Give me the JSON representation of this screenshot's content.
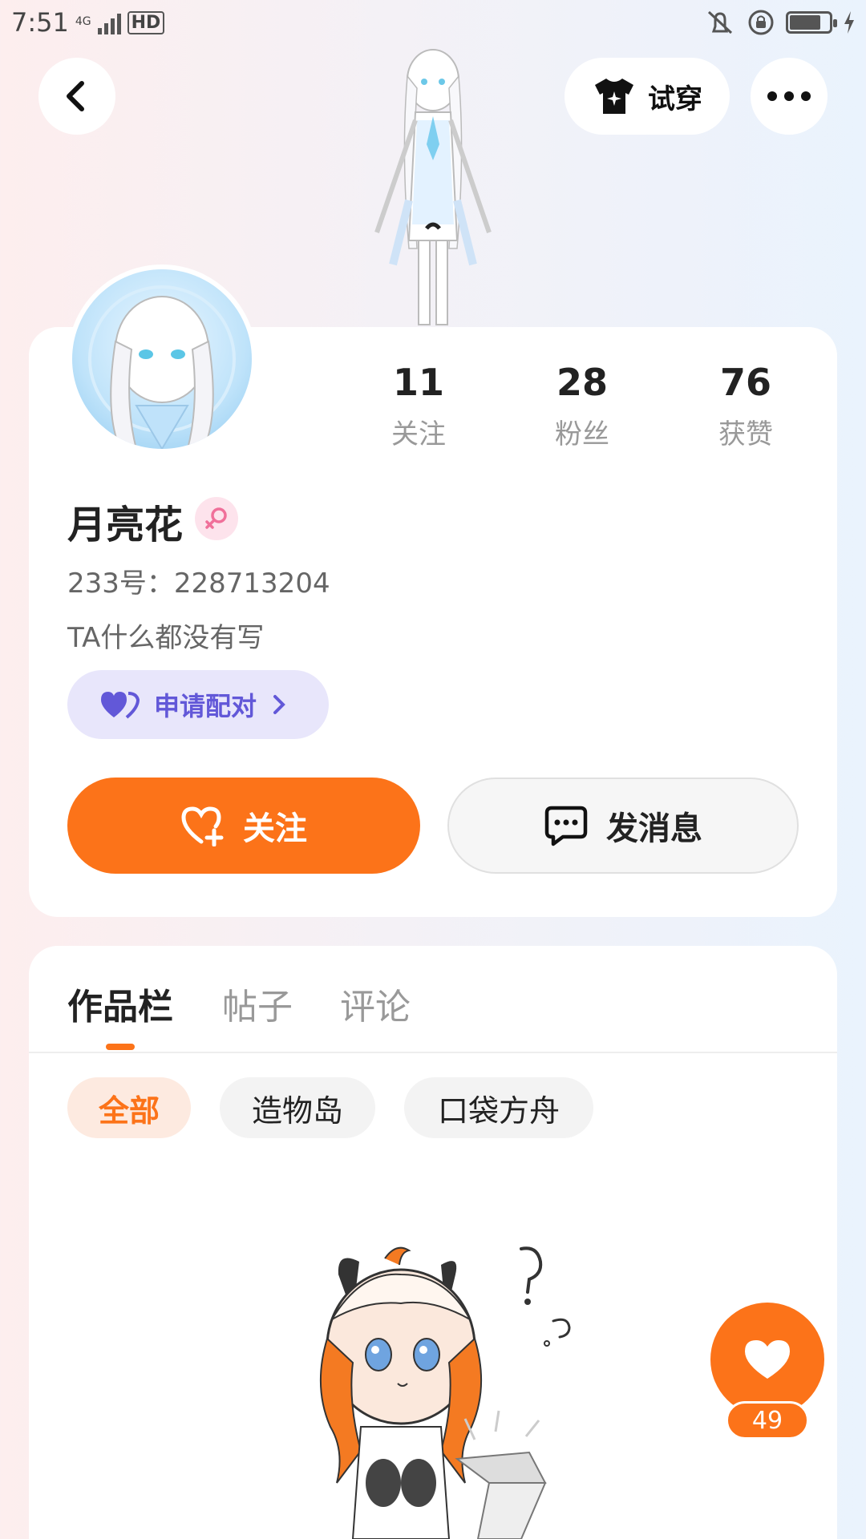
{
  "status_bar": {
    "time": "7:51",
    "network": "4G",
    "hd": "HD"
  },
  "header": {
    "try_on_label": "试穿"
  },
  "profile": {
    "name": "月亮花",
    "uid": "233号：228713204",
    "bio": "TA什么都没有写",
    "pair_label": "申请配对",
    "stats": [
      {
        "value": "11",
        "label": "关注"
      },
      {
        "value": "28",
        "label": "粉丝"
      },
      {
        "value": "76",
        "label": "获赞"
      }
    ]
  },
  "actions": {
    "follow_label": "关注",
    "message_label": "发消息"
  },
  "tabs": [
    {
      "label": "作品栏",
      "active": true
    },
    {
      "label": "帖子",
      "active": false
    },
    {
      "label": "评论",
      "active": false
    }
  ],
  "filters": [
    {
      "label": "全部",
      "active": true
    },
    {
      "label": "造物岛",
      "active": false
    },
    {
      "label": "口袋方舟",
      "active": false
    }
  ],
  "like": {
    "count": "49"
  },
  "colors": {
    "accent": "#fc7319",
    "pair_bg": "#e8e6fb",
    "pair_text": "#6258d8",
    "gender_bg": "#fde3ec"
  }
}
